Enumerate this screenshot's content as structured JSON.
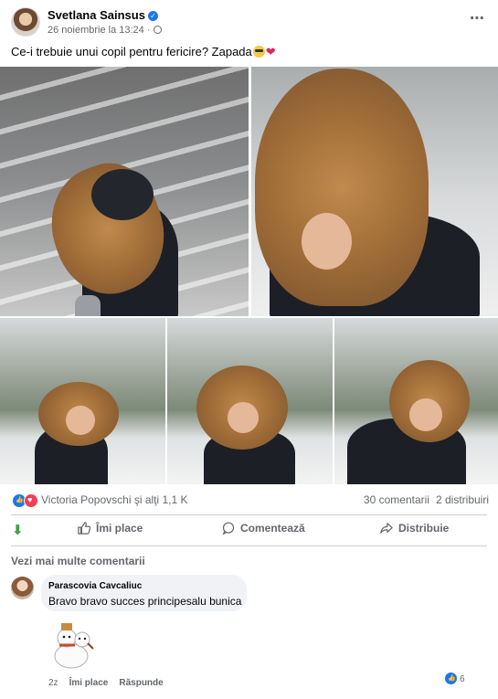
{
  "post": {
    "author": "Svetlana Sainsus",
    "timestamp": "26 noiembrie la 13:24",
    "caption": "Ce-i trebuie unui copil pentru fericire? Zapada",
    "more_icon": "⋯"
  },
  "reactions": {
    "names": "Victoria Popovschi şi alţi 1,1 K",
    "comments": "30 comentarii",
    "shares": "2 distribuiri",
    "colors": {
      "like": "#1877f2",
      "love": "#f33e58"
    }
  },
  "actions": {
    "boost_icon": "⬇",
    "like": "Îmi place",
    "comment": "Comentează",
    "share": "Distribuie"
  },
  "comments": {
    "view_more": "Vezi mai multe comentarii",
    "items": [
      {
        "author": "Parascovia Cavcaliuc",
        "text": "Bravo bravo succes principesalu bunica",
        "time": "2z",
        "like": "Îmi place",
        "reply": "Răspunde",
        "reaction_count": "6"
      }
    ]
  }
}
